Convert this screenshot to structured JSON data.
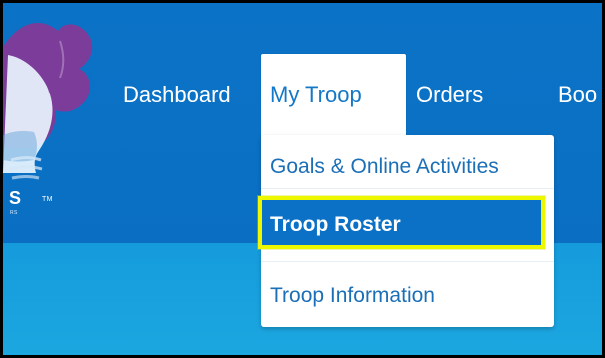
{
  "colors": {
    "header_blue": "#0B73C7",
    "lower_blue": "#1CA7E0",
    "active_tab": "#FFFFFF",
    "menu_text": "#1B6FB7",
    "highlight_fill": "#0B71C6",
    "highlight_border": "#ECF700",
    "logo_accent": "#7C3C99"
  },
  "brand": {
    "partial_text": "S",
    "trademark": "TM",
    "sub_text": "RS"
  },
  "nav": {
    "dashboard": "Dashboard",
    "my_troop": "My Troop",
    "orders": "Orders",
    "bookings_partial": "Boo"
  },
  "menu": {
    "items": [
      {
        "label": "Goals & Online Activities"
      },
      {
        "label": "Troop Roster"
      },
      {
        "label": "Troop Information"
      }
    ]
  },
  "icons": {
    "logo": "lightbulb-logo-icon"
  }
}
